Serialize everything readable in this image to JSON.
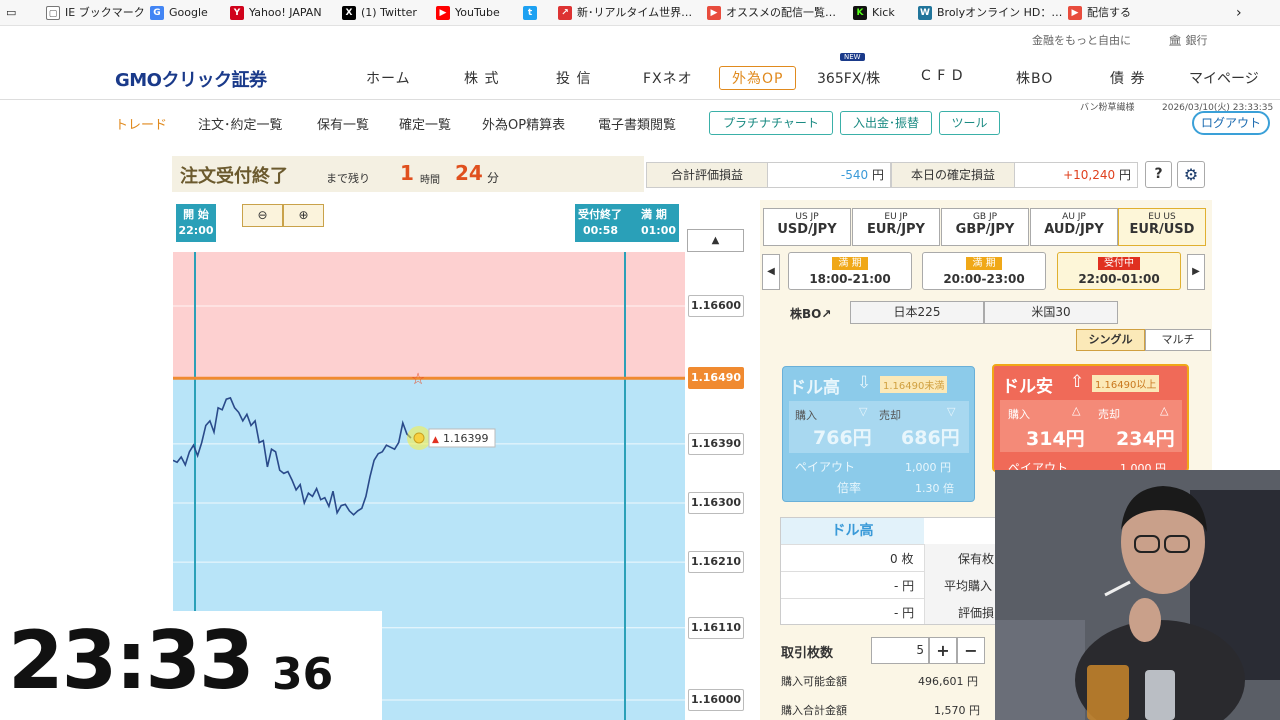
{
  "bookmarks": [
    {
      "label": "IE ブックマーク",
      "icon": "folder-icon"
    },
    {
      "label": "Google",
      "icon": "google-icon"
    },
    {
      "label": "Yahoo! JAPAN",
      "icon": "yahoo-icon"
    },
    {
      "label": "(1) Twitter",
      "icon": "x-icon"
    },
    {
      "label": "YouTube",
      "icon": "youtube-icon"
    },
    {
      "label": "",
      "icon": "twitter-icon"
    },
    {
      "label": "新･リアルタイム世界…",
      "icon": "chart-icon"
    },
    {
      "label": "オススメの配信一覧…",
      "icon": "stream-icon"
    },
    {
      "label": "Kick",
      "icon": "kick-icon"
    },
    {
      "label": "Brolyオンライン HD：…",
      "icon": "wordpress-icon"
    },
    {
      "label": "配信する",
      "icon": "stream-icon"
    }
  ],
  "util": {
    "tagline": "金融をもっと自由に",
    "bank": "銀行"
  },
  "brand": {
    "logo": "GMOクリック証券"
  },
  "nav": {
    "items": [
      "ホーム",
      "株 式",
      "投 信",
      "FXネオ",
      "外為OP",
      "365FX/株",
      "C F D",
      "株BO",
      "債 券",
      "マイページ"
    ],
    "new_badge": "NEW",
    "selected": "外為OP"
  },
  "user": {
    "name": "バン粉草繊様",
    "datetime": "2026/03/10(火) 23:33:35"
  },
  "subnav": {
    "items": [
      "トレード",
      "注文･約定一覧",
      "保有一覧",
      "確定一覧",
      "外為OP精算表",
      "電子書類閲覧"
    ],
    "buttons": [
      "プラチナチャート",
      "入出金･振替",
      "ツール"
    ],
    "logout": "ログアウト"
  },
  "status": {
    "title": "注文受付終了",
    "remain_label": "まで残り",
    "hours": "1",
    "hours_unit": "時間",
    "minutes": "24",
    "minutes_unit": "分"
  },
  "totals": {
    "eval_label": "合計評価損益",
    "eval_value": "-540",
    "eval_unit": "円",
    "today_label": "本日の確定損益",
    "today_value": "+10,240",
    "today_unit": "円",
    "help": "?"
  },
  "chart_labels": {
    "start_label": "開 始",
    "start_time": "22:00",
    "accept_end_label": "受付終了",
    "accept_end_time": "00:58",
    "expiry_label": "満 期",
    "expiry_time": "01:00",
    "current_price": "1.16399"
  },
  "chart_data": {
    "type": "line",
    "strike": 1.1649,
    "price_ticks": [
      "1.16600",
      "1.16490",
      "1.16390",
      "1.16300",
      "1.16210",
      "1.16110",
      "1.16000"
    ],
    "ylim": [
      1.16,
      1.166
    ],
    "values": [
      1.16365,
      1.16362,
      1.1637,
      1.16358,
      1.16378,
      1.16388,
      1.16372,
      1.16392,
      1.16418,
      1.16425,
      1.16408,
      1.16445,
      1.16442,
      1.16458,
      1.1646,
      1.16445,
      1.16438,
      1.16425,
      1.16435,
      1.16418,
      1.16425,
      1.16392,
      1.16395,
      1.16355,
      1.16382,
      1.16378,
      1.1635,
      1.16345,
      1.16348,
      1.16335,
      1.1632,
      1.16328,
      1.163,
      1.16315,
      1.1631,
      1.16322,
      1.16305,
      1.16308,
      1.16295,
      1.16318,
      1.16285,
      1.16296,
      1.16298,
      1.16288,
      1.16282,
      1.16288,
      1.16292,
      1.1631,
      1.1634,
      1.16365,
      1.16375,
      1.16378,
      1.16388,
      1.16385,
      1.16382,
      1.16392,
      1.16422,
      1.16405,
      1.16399
    ]
  },
  "pairs": [
    {
      "name": "USD/JPY",
      "flags": "US JP"
    },
    {
      "name": "EUR/JPY",
      "flags": "EU JP"
    },
    {
      "name": "GBP/JPY",
      "flags": "GB JP"
    },
    {
      "name": "AUD/JPY",
      "flags": "AU JP"
    },
    {
      "name": "EUR/USD",
      "flags": "EU US"
    }
  ],
  "times": [
    {
      "status": "満 期",
      "range": "18:00-21:00"
    },
    {
      "status": "満 期",
      "range": "20:00-23:00"
    },
    {
      "status": "受付中",
      "range": "22:00-01:00"
    }
  ],
  "stock_bo": {
    "label": "株BO↗",
    "items": [
      "日本225",
      "米国30"
    ]
  },
  "mode": [
    "シングル",
    "マルチ"
  ],
  "high": {
    "title": "ドル高",
    "cond": "1.16490未満",
    "buy_label": "購入",
    "sell_label": "売却",
    "buy": "766円",
    "sell": "686円",
    "payout_label": "ペイアウト",
    "payout": "1,000 円",
    "rate_label": "倍率",
    "rate": "1.30 倍"
  },
  "low": {
    "title": "ドル安",
    "cond": "1.16490以上",
    "buy_label": "購入",
    "sell_label": "売却",
    "buy": "314円",
    "sell": "234円",
    "payout_label": "ペイアウト",
    "payout": "1,000 円"
  },
  "holdings": {
    "col": "ドル高",
    "row1": "0 枚",
    "row2": "- 円",
    "row3": "- 円",
    "labels": [
      "保有枚",
      "平均購入",
      "評価損"
    ]
  },
  "order": {
    "qty_label": "取引枚数",
    "qty": "5",
    "plus": "+",
    "minus": "−",
    "avail_label": "購入可能金額",
    "avail": "496,601 円",
    "total_label": "購入合計金額",
    "total": "1,570 円"
  },
  "clock": {
    "hm": "23:33",
    "sec": "36"
  },
  "colors": {
    "accent": "#e08a1e",
    "brand": "#1a3a8a",
    "strike": "#f08a30",
    "high_zone": "#b8e4f8",
    "low_zone": "#fdd0d0"
  }
}
